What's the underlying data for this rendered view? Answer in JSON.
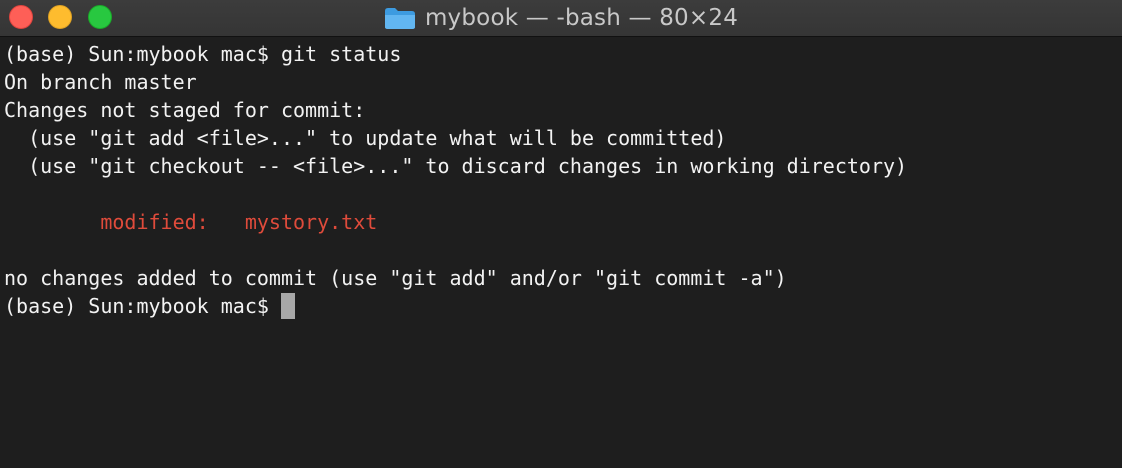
{
  "window": {
    "title": "mybook — -bash — 80×24",
    "folder_icon": "folder-icon",
    "colors": {
      "background": "#1e1e1e",
      "text": "#f2f2f2",
      "modified": "#df4b3b",
      "close": "#fe5f57",
      "minimize": "#febc2e",
      "zoom": "#28c840"
    }
  },
  "terminal": {
    "lines": [
      "(base) Sun:mybook mac$ git status",
      "On branch master",
      "Changes not staged for commit:",
      "  (use \"git add <file>...\" to update what will be committed)",
      "  (use \"git checkout -- <file>...\" to discard changes in working directory)",
      "",
      "        modified:   mystory.txt",
      "",
      "no changes added to commit (use \"git add\" and/or \"git commit -a\")"
    ],
    "prompt": "(base) Sun:mybook mac$ "
  }
}
